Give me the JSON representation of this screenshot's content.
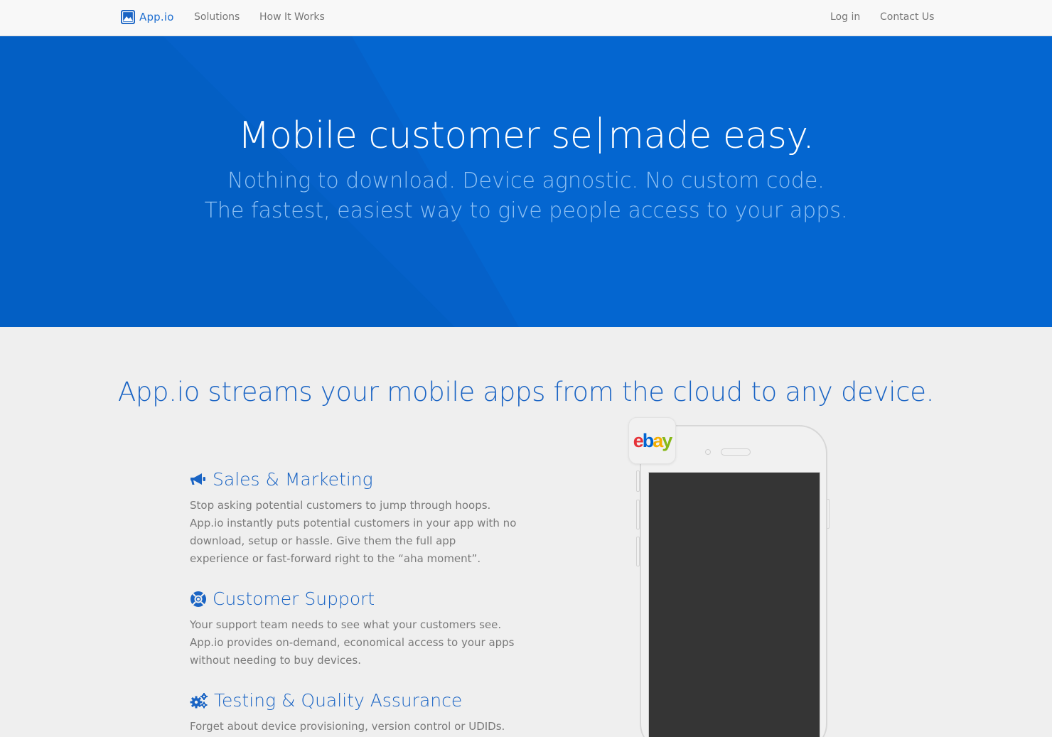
{
  "nav": {
    "logo_text": "App.io",
    "links": [
      {
        "label": "Solutions"
      },
      {
        "label": "How It Works"
      },
      {
        "label": "Log in"
      },
      {
        "label": "Contact Us"
      }
    ]
  },
  "hero": {
    "title_before_caret": "Mobile customer se",
    "title_after_caret": "made easy.",
    "subtitle_line1": "Nothing to download. Device agnostic. No custom code.",
    "subtitle_line2": "The fastest, easiest way to give people access to your apps."
  },
  "section": {
    "title": "App.io streams your mobile apps from the cloud to any device."
  },
  "features": [
    {
      "icon": "megaphone-icon",
      "title": "Sales & Marketing",
      "body": "Stop asking potential customers to jump through hoops. App.io instantly puts potential customers in your app with no download, setup or hassle. Give them the full app experience or fast-forward right to the “aha moment”."
    },
    {
      "icon": "life-ring-icon",
      "title": "Customer Support",
      "body": "Your support team needs to see what your customers see. App.io provides on-demand, economical access to your apps without needing to buy devices."
    },
    {
      "icon": "gears-icon",
      "title": "Testing & Quality Assurance",
      "body": "Forget about device provisioning, version control or UDIDs."
    }
  ],
  "app_tile": {
    "letters": [
      "e",
      "b",
      "a",
      "y"
    ],
    "colors": [
      "#e53238",
      "#0064d2",
      "#f5af02",
      "#86b817"
    ]
  },
  "colors": {
    "brand_blue": "#1a64c4",
    "hero_blue": "#0466d0",
    "hero_subtitle": "#8ec0f3",
    "body_text": "#7a7a7a",
    "nav_text": "#777777"
  }
}
